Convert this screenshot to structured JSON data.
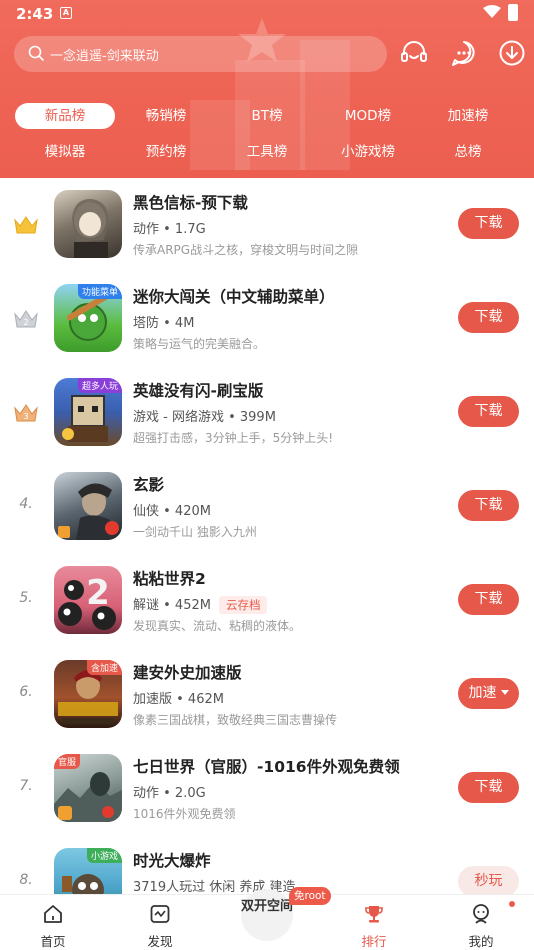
{
  "status_bar": {
    "time": "2:43",
    "sim_label": "A"
  },
  "search": {
    "placeholder": "一念逍遥-剑来联动"
  },
  "header_icons": [
    "headset-icon",
    "chat-icon",
    "download-icon"
  ],
  "tabs_row1": [
    {
      "label": "新品榜",
      "active": true
    },
    {
      "label": "畅销榜",
      "active": false
    },
    {
      "label": "BT榜",
      "active": false
    },
    {
      "label": "MOD榜",
      "active": false
    },
    {
      "label": "加速榜",
      "active": false
    }
  ],
  "tabs_row2": [
    {
      "label": "模拟器"
    },
    {
      "label": "预约榜"
    },
    {
      "label": "工具榜"
    },
    {
      "label": "小游戏榜"
    },
    {
      "label": "总榜"
    }
  ],
  "apps": [
    {
      "rank": "1",
      "medal": "gold",
      "name": "黑色信标-预下载",
      "meta": "动作 • 1.7G",
      "badge": "",
      "desc": "传承ARPG战斗之核，穿梭文明与时间之隙",
      "action": "下载",
      "icon_tag": ""
    },
    {
      "rank": "2",
      "medal": "silver",
      "name": "迷你大闯关（中文辅助菜单）",
      "meta": "塔防 • 4M",
      "badge": "",
      "desc": "策略与运气的完美融合。",
      "action": "下载",
      "icon_tag": "功能菜单"
    },
    {
      "rank": "3",
      "medal": "bronze",
      "name": "英雄没有闪-刷宝版",
      "meta": "游戏 - 网络游戏 • 399M",
      "badge": "",
      "desc": "超强打击感，3分钟上手，5分钟上头!",
      "action": "下载",
      "icon_tag": "超多人玩"
    },
    {
      "rank": "4.",
      "medal": "",
      "name": "玄影",
      "meta": "仙侠 • 420M",
      "badge": "",
      "desc": "一剑动千山 独影入九州",
      "action": "下载",
      "icon_tag": ""
    },
    {
      "rank": "5.",
      "medal": "",
      "name": "粘粘世界2",
      "meta": "解谜 • 452M",
      "badge": "云存档",
      "desc": "发现真实、流动、粘稠的液体。",
      "action": "下载",
      "icon_tag": ""
    },
    {
      "rank": "6.",
      "medal": "",
      "name": "建安外史加速版",
      "meta": "加速版 • 462M",
      "badge": "",
      "desc": "像素三国战棋，致敬经典三国志曹操传",
      "action": "加速",
      "icon_tag": "含加速"
    },
    {
      "rank": "7.",
      "medal": "",
      "name": "七日世界（官服）-1016件外观免费领",
      "meta": "动作 • 2.0G",
      "badge": "",
      "desc": "1016件外观免费领",
      "action": "下载",
      "icon_tag": "官服"
    },
    {
      "rank": "8.",
      "medal": "",
      "name": "时光大爆炸",
      "meta": "3719人玩过 休闲 养成 建造",
      "badge": "",
      "desc": "",
      "action": "秒玩",
      "icon_tag": "小游戏"
    }
  ],
  "bottom_nav": {
    "home": "首页",
    "discover": "发现",
    "center": "双开空间",
    "center_badge": "免root",
    "ranking": "排行",
    "mine": "我的"
  },
  "colors": {
    "brand": "#e6594a",
    "header": "#ee6354"
  }
}
